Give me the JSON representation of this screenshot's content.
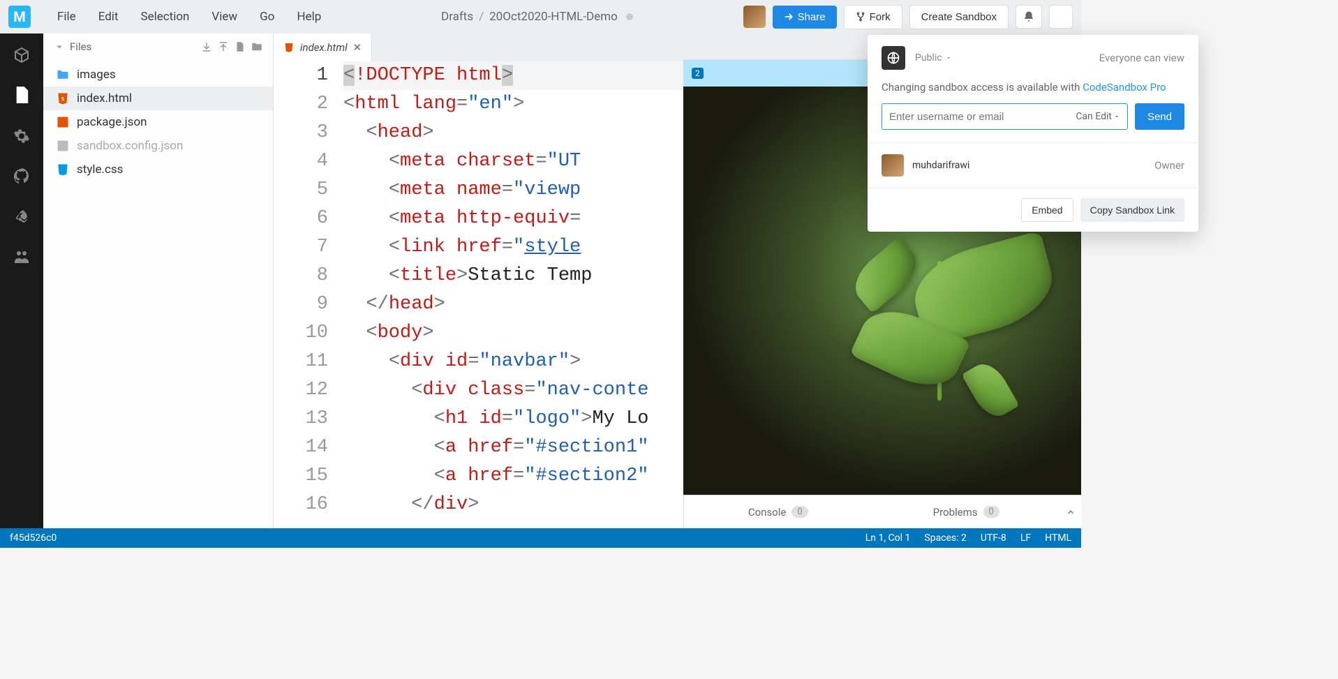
{
  "logo_letter": "M",
  "menus": [
    "File",
    "Edit",
    "Selection",
    "View",
    "Go",
    "Help"
  ],
  "breadcrumb": {
    "root": "Drafts",
    "sep": "/",
    "name": "20Oct2020-HTML-Demo"
  },
  "header_buttons": {
    "share": "Share",
    "fork": "Fork",
    "create": "Create Sandbox"
  },
  "filetree": {
    "title": "Files",
    "items": [
      {
        "name": "images",
        "icon": "folder"
      },
      {
        "name": "index.html",
        "icon": "html",
        "active": true
      },
      {
        "name": "package.json",
        "icon": "json"
      },
      {
        "name": "sandbox.config.json",
        "icon": "config",
        "dim": true
      },
      {
        "name": "style.css",
        "icon": "css"
      }
    ]
  },
  "tab": {
    "name": "index.html"
  },
  "code_lines": 16,
  "share_popover": {
    "visibility": "Public",
    "headline": "Everyone can view",
    "note_pre": "Changing sandbox access is available with ",
    "note_link": "CodeSandbox Pro",
    "input_placeholder": "Enter username or email",
    "perm": "Can Edit",
    "send": "Send",
    "member": "muhdarifrawi",
    "role": "Owner",
    "embed": "Embed",
    "copy": "Copy Sandbox Link"
  },
  "preview": {
    "url_badge": "2",
    "console": "Console",
    "console_badge": "0",
    "problems": "Problems",
    "problems_badge": "0"
  },
  "statusbar": {
    "commit": "f45d526c0",
    "pos": "Ln 1, Col 1",
    "spaces": "Spaces: 2",
    "encoding": "UTF-8",
    "eol": "LF",
    "lang": "HTML"
  }
}
